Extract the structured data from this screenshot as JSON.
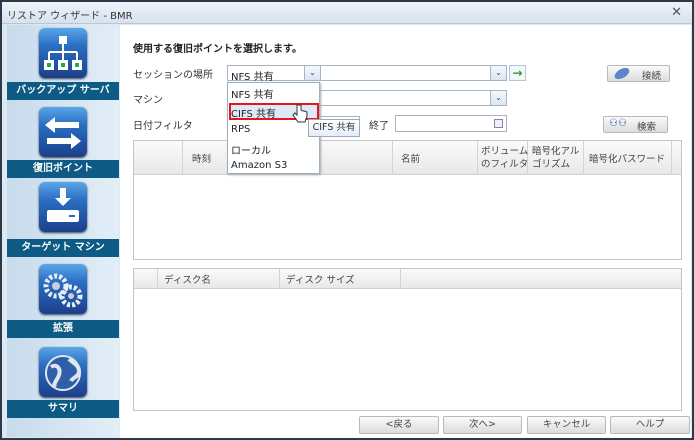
{
  "window": {
    "title": "リストア ウィザード - BMR",
    "close": "✕"
  },
  "sidebar": {
    "items": [
      {
        "label": "バックアップ サーバ",
        "icon": "network-icon"
      },
      {
        "label": "復旧ポイント",
        "icon": "arrows-icon"
      },
      {
        "label": "ターゲット マシン",
        "icon": "download-drive-icon"
      },
      {
        "label": "拡張",
        "icon": "gears-icon"
      },
      {
        "label": "サマリ",
        "icon": "globe-icon"
      }
    ]
  },
  "main": {
    "instruction": "使用する復旧ポイントを選択します。",
    "session_label": "セッションの場所",
    "session_value": "NFS 共有",
    "session_options": [
      "NFS 共有",
      "CIFS 共有",
      "RPS",
      "ローカル",
      "Amazon S3"
    ],
    "hovered_option": "CIFS 共有",
    "tooltip": "CIFS 共有",
    "connect_button": "接続",
    "machine_label": "マシン",
    "date_filter_label": "日付フィルタ",
    "end_label": "終了",
    "search_button": "検索",
    "points_table": {
      "columns": [
        "時刻",
        "名前",
        "ボリューム\nのフィルタ",
        "暗号化アル\nゴリズム",
        "暗号化パスワード"
      ]
    },
    "disk_table": {
      "columns": [
        "ディスク名",
        "ディスク サイズ"
      ]
    }
  },
  "footer": {
    "back": "<戻る",
    "next": "次へ>",
    "cancel": "キャンセル",
    "help": "ヘルプ"
  },
  "colors": {
    "sidebar_label": "#0d5b84",
    "highlight": "#e5161e"
  }
}
